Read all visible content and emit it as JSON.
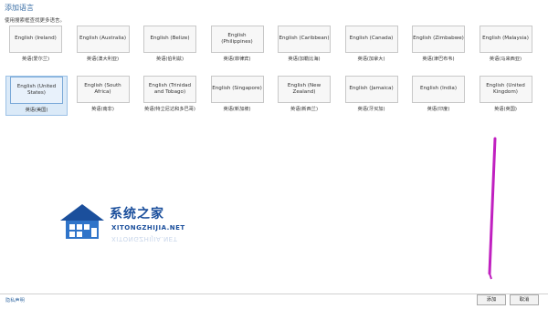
{
  "header": {
    "title": "添加语言",
    "hint": "使用搜索框查找更多语言。"
  },
  "languages": [
    {
      "name": "English (Ireland)",
      "native": "英语(爱尔兰)"
    },
    {
      "name": "English (Australia)",
      "native": "英语(澳大利亚)"
    },
    {
      "name": "English (Belize)",
      "native": "英语(伯利兹)"
    },
    {
      "name": "English (Philippines)",
      "native": "英语(菲律宾)"
    },
    {
      "name": "English (Caribbean)",
      "native": "英语(加勒比海)"
    },
    {
      "name": "English (Canada)",
      "native": "英语(加拿大)"
    },
    {
      "name": "English (Zimbabwe)",
      "native": "英语(津巴布韦)"
    },
    {
      "name": "English (Malaysia)",
      "native": "英语(马来西亚)"
    },
    {
      "name": "English (United States)",
      "native": "英语(美国)",
      "selected": true
    },
    {
      "name": "English (South Africa)",
      "native": "英语(南非)"
    },
    {
      "name": "English (Trinidad and Tobago)",
      "native": "英语(特立尼达和多巴哥)"
    },
    {
      "name": "English (Singapore)",
      "native": "英语(新加坡)"
    },
    {
      "name": "English (New Zealand)",
      "native": "英语(新西兰)"
    },
    {
      "name": "English (Jamaica)",
      "native": "英语(牙买加)"
    },
    {
      "name": "English (India)",
      "native": "英语(印度)"
    },
    {
      "name": "English (United Kingdom)",
      "native": "英语(英国)"
    }
  ],
  "footer": {
    "privacy_link": "隐私声明",
    "add_label": "添加",
    "cancel_label": "取消"
  },
  "watermark": {
    "title": "系统之家",
    "site": "XITONGZHIJIA.NET"
  },
  "colors": {
    "accent": "#3a6ea5",
    "selected_bg": "#dbeaf8",
    "annotation_stroke": "#c020c0"
  }
}
